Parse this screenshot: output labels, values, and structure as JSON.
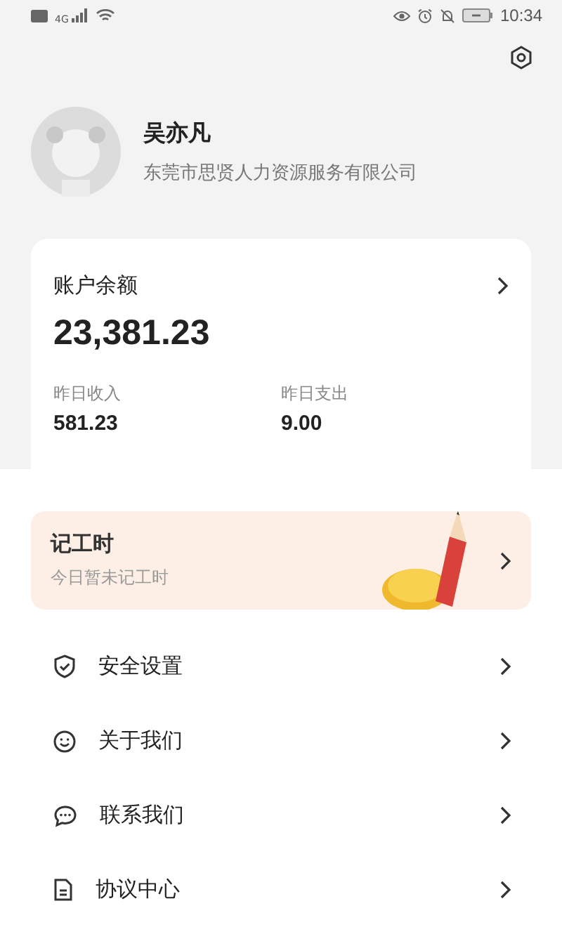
{
  "status_bar": {
    "time": "10:34",
    "network": "4G"
  },
  "profile": {
    "name": "吴亦凡",
    "company": "东莞市思贤人力资源服务有限公司"
  },
  "balance": {
    "title": "账户余额",
    "amount": "23,381.23",
    "stats": [
      {
        "label": "昨日收入",
        "value": "581.23"
      },
      {
        "label": "昨日支出",
        "value": "9.00"
      }
    ]
  },
  "work_hours": {
    "title": "记工时",
    "subtitle": "今日暂未记工时"
  },
  "menu": [
    {
      "kind": "shield",
      "label": "安全设置"
    },
    {
      "kind": "smile",
      "label": "关于我们"
    },
    {
      "kind": "chat",
      "label": "联系我们"
    },
    {
      "kind": "document",
      "label": "协议中心"
    }
  ]
}
